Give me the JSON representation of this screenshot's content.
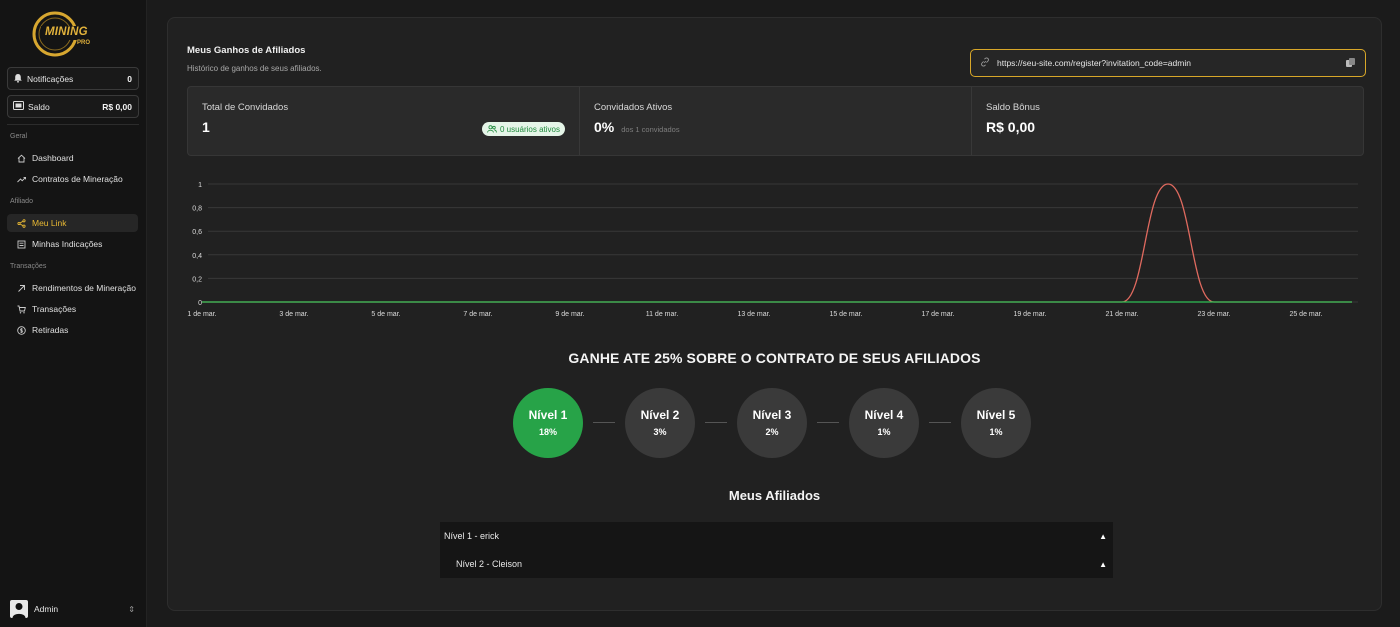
{
  "brand": {
    "logo_text": "MINING",
    "logo_sub": "PRO"
  },
  "sidebar": {
    "notifications": {
      "label": "Notificações",
      "count": "0"
    },
    "balance": {
      "label": "Saldo",
      "value": "R$ 0,00"
    },
    "sections": [
      {
        "title": "Geral",
        "items": [
          {
            "label": "Dashboard",
            "icon": "home-icon"
          },
          {
            "label": "Contratos de Mineração",
            "icon": "trend-up-icon"
          }
        ]
      },
      {
        "title": "Afiliado",
        "items": [
          {
            "label": "Meu Link",
            "icon": "share-icon",
            "active": true
          },
          {
            "label": "Minhas Indicações",
            "icon": "list-icon"
          }
        ]
      },
      {
        "title": "Transações",
        "items": [
          {
            "label": "Rendimentos de Mineração",
            "icon": "arrow-up-right-icon"
          },
          {
            "label": "Transações",
            "icon": "cart-icon"
          },
          {
            "label": "Retiradas",
            "icon": "dollar-circle-icon"
          }
        ]
      }
    ],
    "user": {
      "name": "Admin"
    }
  },
  "main": {
    "title": "Meus Ganhos de Afiliados",
    "subtitle": "Histórico de ganhos de seus afiliados.",
    "invite_link": "https://seu-site.com/register?invitation_code=admin",
    "stats": [
      {
        "title": "Total de Convidados",
        "value": "1",
        "badge": "0 usuários ativos"
      },
      {
        "title": "Convidados Ativos",
        "value": "0%",
        "note": "dos 1 convidados"
      },
      {
        "title": "Saldo Bônus",
        "value": "R$ 0,00"
      }
    ],
    "headline": "GANHE ATE 25% SOBRE O CONTRATO DE SEUS AFILIADOS",
    "levels": [
      {
        "name": "Nível 1",
        "pct": "18%",
        "active": true
      },
      {
        "name": "Nível 2",
        "pct": "3%"
      },
      {
        "name": "Nível 3",
        "pct": "2%"
      },
      {
        "name": "Nível 4",
        "pct": "1%"
      },
      {
        "name": "Nível 5",
        "pct": "1%"
      }
    ],
    "affiliates_title": "Meus Afiliados",
    "affiliates": [
      {
        "label": "Nível 1 - erick"
      },
      {
        "label": "Nível 2 - Cleison"
      }
    ]
  },
  "colors": {
    "accent": "#e8b833",
    "active_level": "#27a348",
    "series_red": "#e06a5f",
    "series_green": "#2fbf55"
  },
  "chart_data": {
    "type": "line",
    "x": [
      "1 de mar.",
      "2 de mar.",
      "3 de mar.",
      "4 de mar.",
      "5 de mar.",
      "6 de mar.",
      "7 de mar.",
      "8 de mar.",
      "9 de mar.",
      "10 de mar.",
      "11 de mar.",
      "12 de mar.",
      "13 de mar.",
      "14 de mar.",
      "15 de mar.",
      "16 de mar.",
      "17 de mar.",
      "18 de mar.",
      "19 de mar.",
      "20 de mar.",
      "21 de mar.",
      "22 de mar.",
      "23 de mar.",
      "24 de mar.",
      "25 de mar.",
      "26 de mar."
    ],
    "tick_labels": [
      "1 de mar.",
      "3 de mar.",
      "5 de mar.",
      "7 de mar.",
      "9 de mar.",
      "11 de mar.",
      "13 de mar.",
      "15 de mar.",
      "17 de mar.",
      "19 de mar.",
      "21 de mar.",
      "23 de mar.",
      "25 de mar."
    ],
    "series": [
      {
        "color": "#e06a5f",
        "values": [
          0,
          0,
          0,
          0,
          0,
          0,
          0,
          0,
          0,
          0,
          0,
          0,
          0,
          0,
          0,
          0,
          0,
          0,
          0,
          0,
          0,
          1,
          0,
          0,
          0,
          0
        ]
      },
      {
        "color": "#2fbf55",
        "values": [
          0,
          0,
          0,
          0,
          0,
          0,
          0,
          0,
          0,
          0,
          0,
          0,
          0,
          0,
          0,
          0,
          0,
          0,
          0,
          0,
          0,
          0,
          0,
          0,
          0,
          0
        ]
      }
    ],
    "y_ticks": [
      "0",
      "0,2",
      "0,4",
      "0,6",
      "0,8",
      "1"
    ],
    "ylim": [
      0,
      1
    ],
    "grid": true,
    "legend": false
  }
}
